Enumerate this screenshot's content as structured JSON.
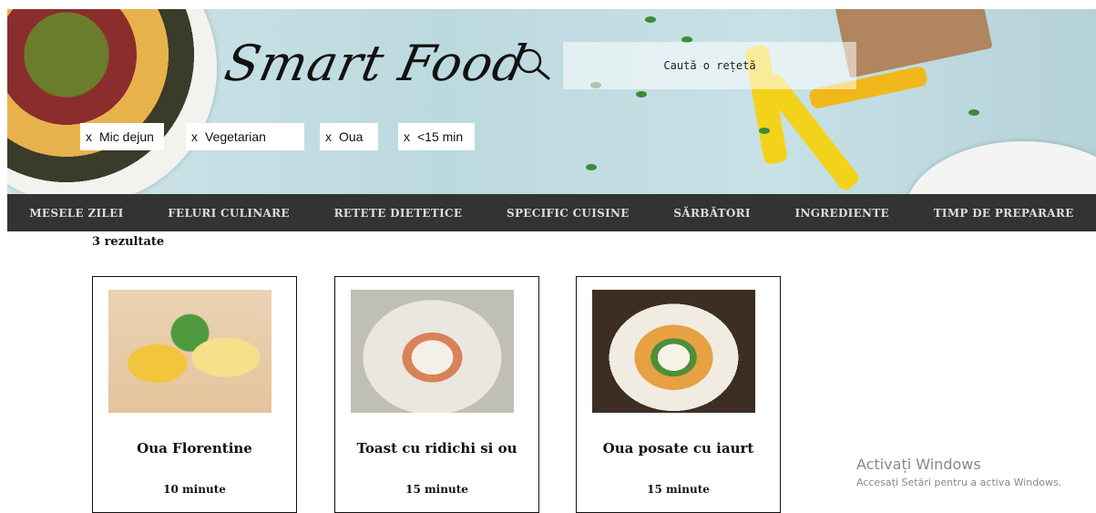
{
  "header": {
    "logo_text": "Smart Food",
    "search_placeholder": "Caută o rețetă"
  },
  "filters": [
    {
      "label": "Mic dejun",
      "remove": "x"
    },
    {
      "label": "Vegetarian",
      "remove": "x"
    },
    {
      "label": "Oua",
      "remove": "x"
    },
    {
      "label": "<15 min",
      "remove": "x"
    }
  ],
  "nav": [
    "MESELE ZILEI",
    "FELURI CULINARE",
    "RETETE DIETETICE",
    "SPECIFIC CUISINE",
    "SĂRBĂTORI",
    "INGREDIENTE",
    "TIMP DE PREPARARE"
  ],
  "results_count": "3 rezultate",
  "recipes": [
    {
      "title": "Oua Florentine",
      "time": "10 minute"
    },
    {
      "title": "Toast cu ridichi si ou",
      "time": "15 minute"
    },
    {
      "title": "Oua posate cu iaurt",
      "time": "15 minute"
    }
  ],
  "watermark": {
    "line1": "Activați Windows",
    "line2": "Accesați Setări pentru a activa Windows."
  }
}
